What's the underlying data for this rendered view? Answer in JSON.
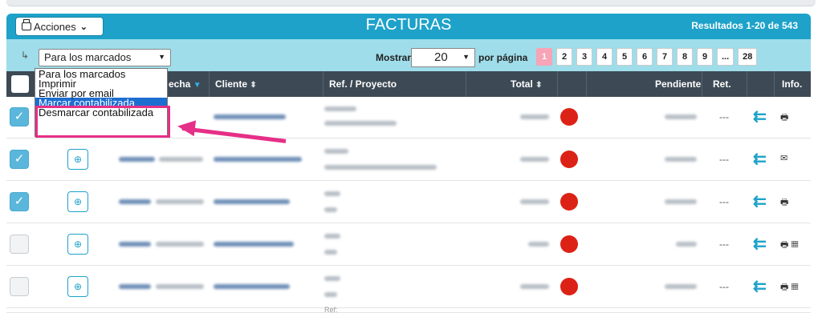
{
  "header": {
    "actions_label": "Acciones",
    "title": "FACTURAS",
    "results": "Resultados 1-20 de 543"
  },
  "toolbar": {
    "bulk_select_value": "Para los marcados",
    "show_label": "Mostrar",
    "per_page_value": "20",
    "per_page_suffix": "por página",
    "pages": [
      "1",
      "2",
      "3",
      "4",
      "5",
      "6",
      "7",
      "8",
      "9",
      "...",
      "28"
    ],
    "active_page": "1"
  },
  "dropdown": {
    "options": [
      "Para los marcados",
      "Imprimir",
      "Enviar por email",
      "Marcar contabilizada",
      "Desmarcar contabilizada"
    ],
    "highlighted": "Marcar contabilizada"
  },
  "table": {
    "columns": [
      "echa",
      "Cliente",
      "Ref. / Proyecto",
      "Total",
      "Pendiente",
      "Ret.",
      "Info."
    ],
    "rows": [
      {
        "checked": true,
        "ret": "---",
        "info_icon": "print-icon"
      },
      {
        "checked": true,
        "ret": "---",
        "info_icon": "mail-icon"
      },
      {
        "checked": true,
        "ret": "---",
        "info_icon": "print-icon"
      },
      {
        "checked": false,
        "ret": "---",
        "info_icon": "print-calculator-icon"
      },
      {
        "checked": false,
        "ret": "---",
        "info_icon": "print-calculator-icon"
      }
    ],
    "partial_row_ref": "Ref:"
  },
  "colors": {
    "header": "#1ea2c9",
    "toolbar": "#9edde9",
    "table_head": "#3d4a55",
    "status_red": "#dc2216",
    "annotation": "#e62f87"
  }
}
